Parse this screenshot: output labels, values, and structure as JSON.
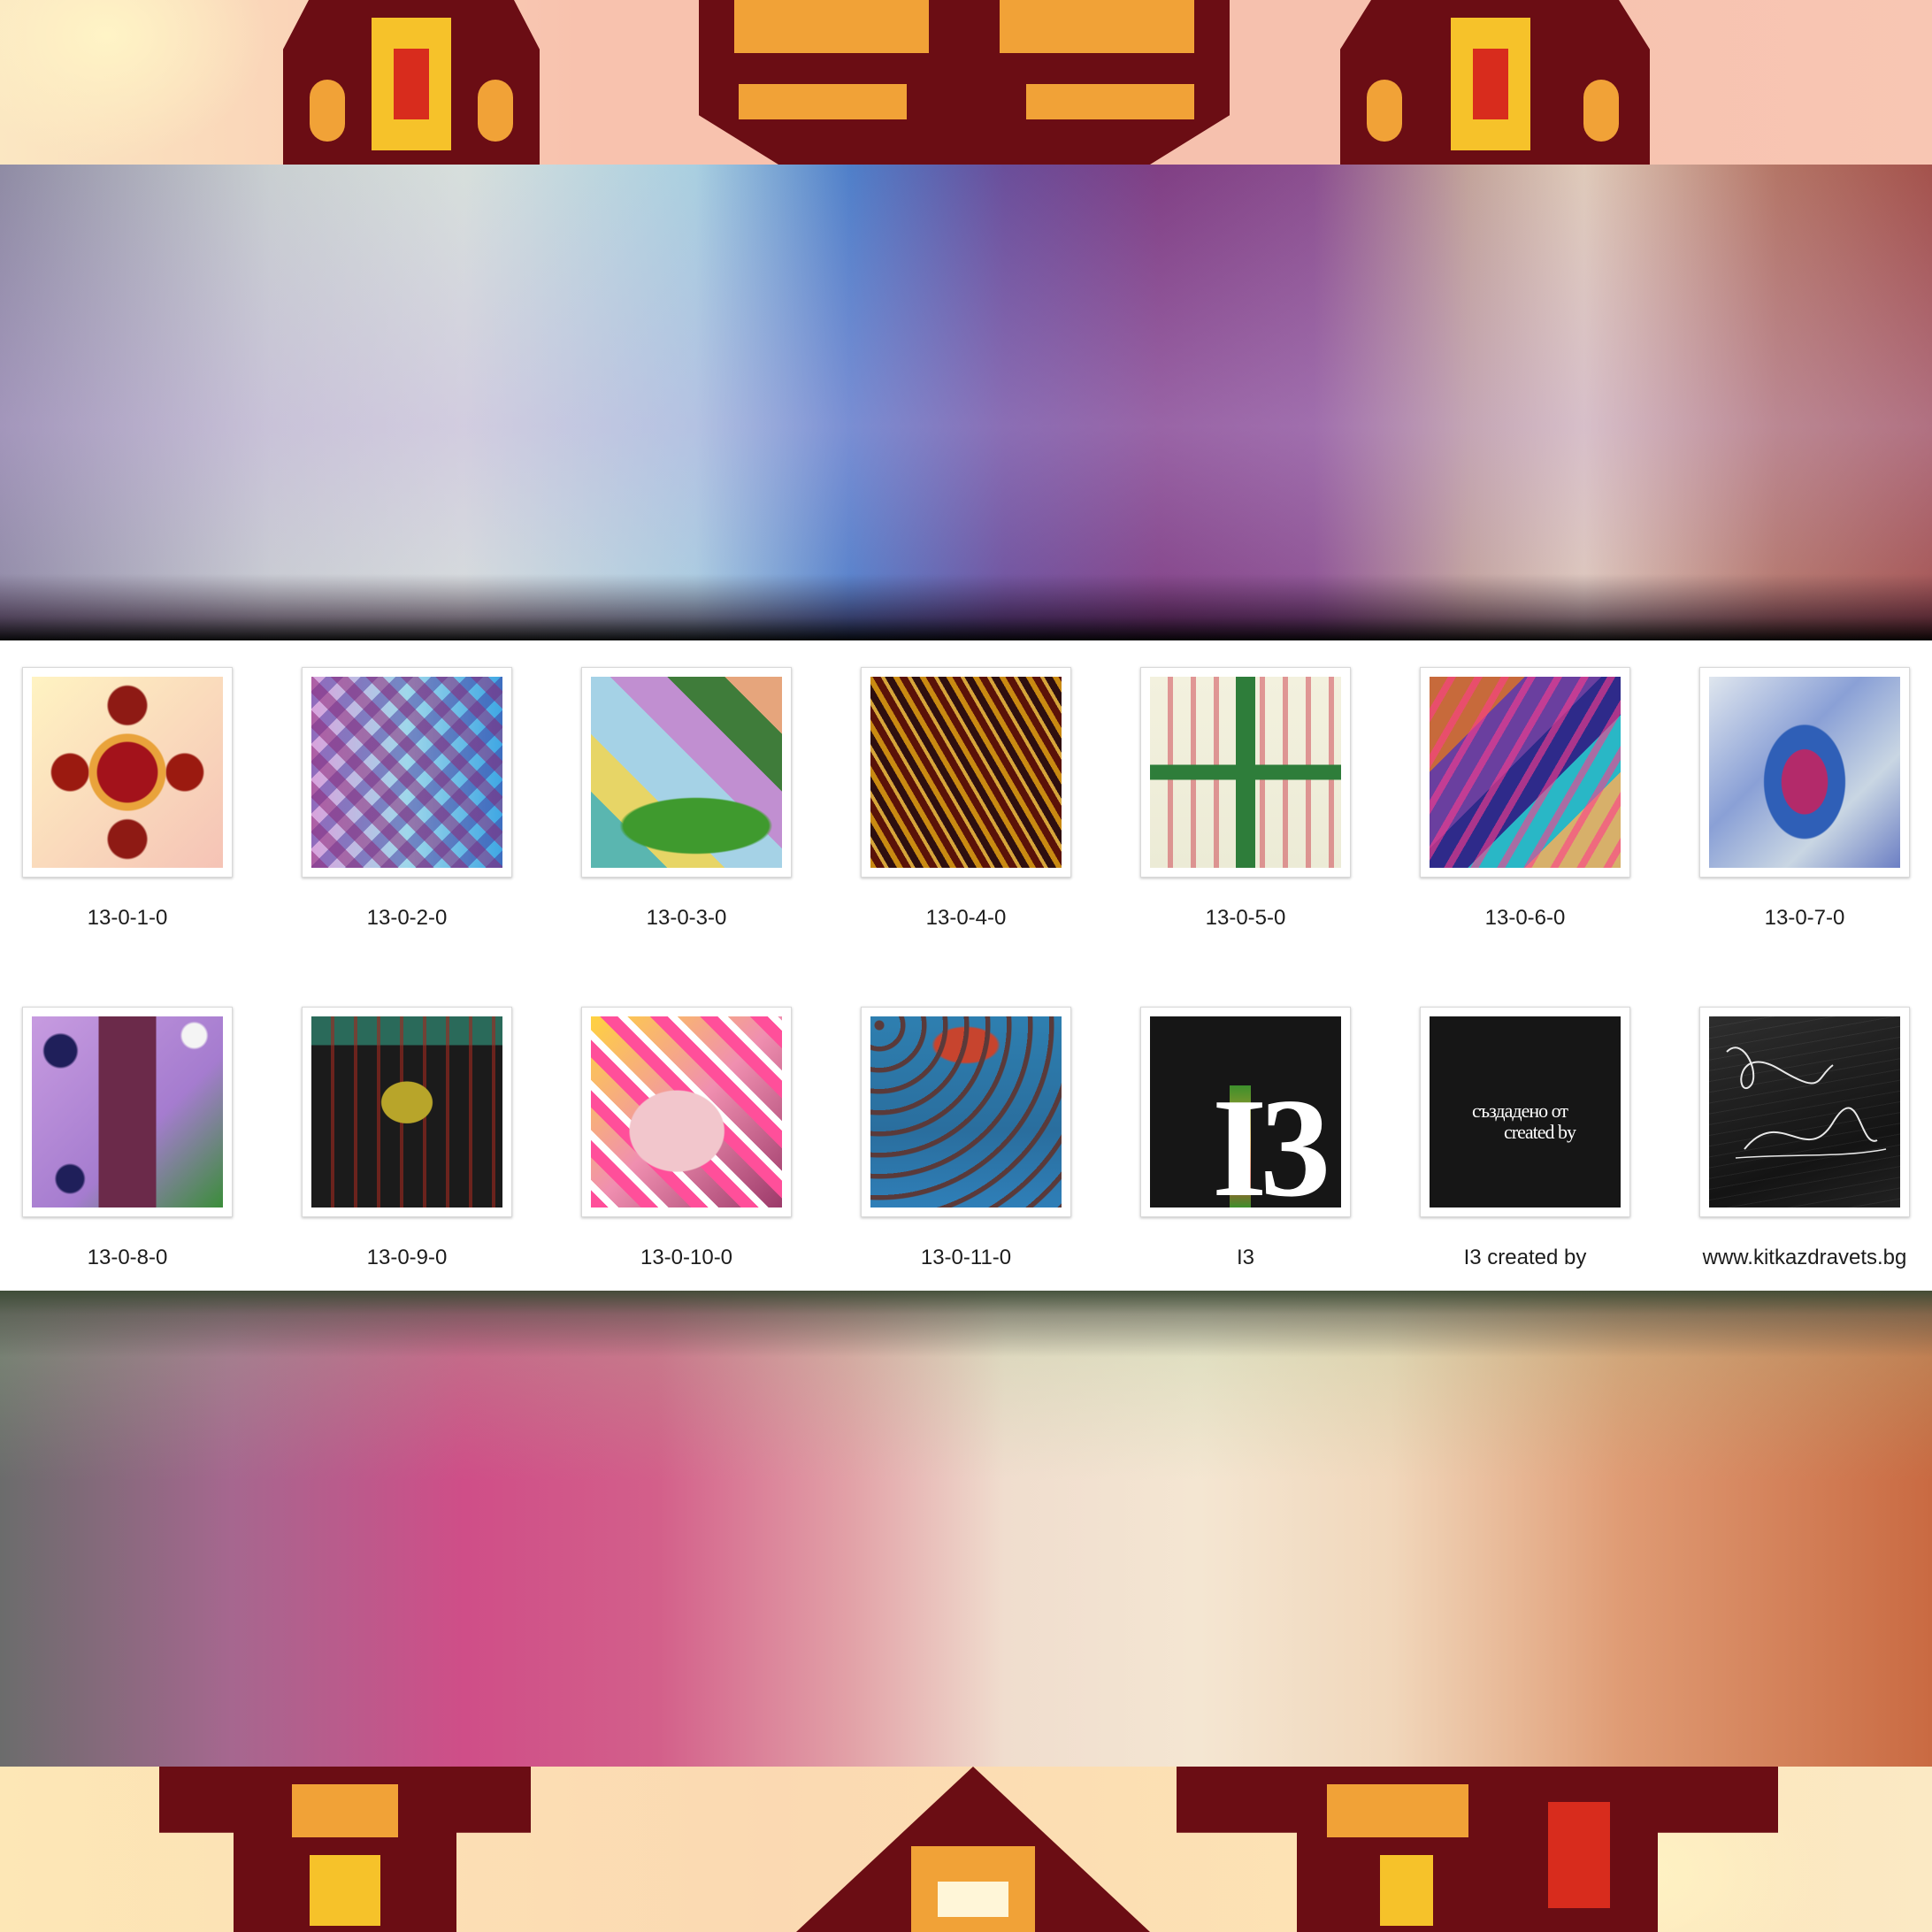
{
  "gallery": {
    "items": [
      {
        "caption": "13-0-1-0"
      },
      {
        "caption": "13-0-2-0"
      },
      {
        "caption": "13-0-3-0"
      },
      {
        "caption": "13-0-4-0"
      },
      {
        "caption": "13-0-5-0"
      },
      {
        "caption": "13-0-6-0"
      },
      {
        "caption": "13-0-7-0"
      },
      {
        "caption": "13-0-8-0"
      },
      {
        "caption": "13-0-9-0"
      },
      {
        "caption": "13-0-10-0"
      },
      {
        "caption": "13-0-11-0"
      },
      {
        "caption": "I3",
        "art_text": "I3"
      },
      {
        "caption": "I3 created by",
        "art_text_1": "създадено от",
        "art_text_2": "created by"
      },
      {
        "caption": "www.kitkazdravets.bg"
      }
    ]
  }
}
